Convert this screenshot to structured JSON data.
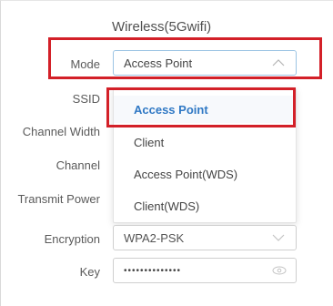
{
  "section": {
    "title": "Wireless(5Gwifi)"
  },
  "labels": {
    "mode": "Mode",
    "ssid": "SSID",
    "channel_width": "Channel Width",
    "channel": "Channel",
    "transmit_power": "Transmit Power",
    "encryption": "Encryption",
    "key": "Key"
  },
  "mode_select": {
    "value": "Access Point"
  },
  "mode_options": [
    {
      "label": "Access Point",
      "selected": true
    },
    {
      "label": "Client",
      "selected": false
    },
    {
      "label": "Access Point(WDS)",
      "selected": false
    },
    {
      "label": "Client(WDS)",
      "selected": false
    }
  ],
  "encryption_select": {
    "value": "WPA2-PSK"
  },
  "key_field": {
    "value": "••••••••••••••"
  },
  "icons": {
    "chevron_up": "chevron-up-icon",
    "chevron_down": "chevron-down-icon",
    "eye": "eye-icon"
  },
  "colors": {
    "highlight": "#d32028",
    "selected_option": "#2f78c4"
  }
}
